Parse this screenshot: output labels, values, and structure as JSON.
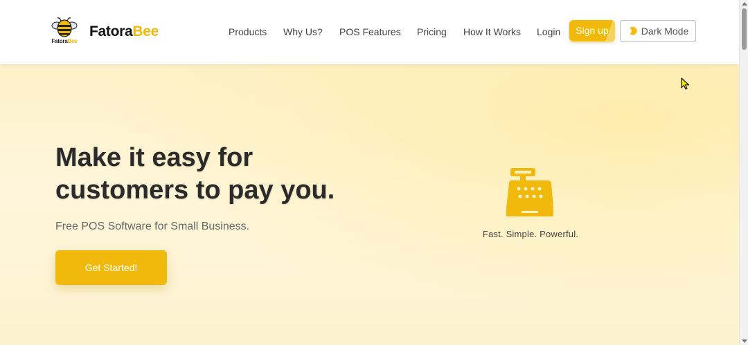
{
  "header": {
    "logo_small_text_1": "Fatora",
    "logo_small_text_2": "Bee",
    "brand_part_1": "Fatora",
    "brand_part_2": "Bee",
    "nav": [
      {
        "label": "Products"
      },
      {
        "label": "Why Us?"
      },
      {
        "label": "POS Features"
      },
      {
        "label": "Pricing"
      },
      {
        "label": "How It Works"
      },
      {
        "label": "Login"
      }
    ],
    "signup_label": "Sign up",
    "darkmode_label": "Dark Mode"
  },
  "hero": {
    "headline_line_1": "Make it easy for",
    "headline_line_2": "customers to pay you.",
    "subtitle": "Free POS Software for Small Business.",
    "cta_label": "Get Started!",
    "tagline": "Fast. Simple. Powerful."
  },
  "colors": {
    "accent": "#f0b90b",
    "hero_bg": "#fdf1c8",
    "text_dark": "#2b2b2b"
  },
  "icons": {
    "logo": "bee-icon",
    "theme_toggle": "moon-icon",
    "hero_graphic": "cash-register-icon",
    "cursor": "mouse-cursor-icon"
  }
}
